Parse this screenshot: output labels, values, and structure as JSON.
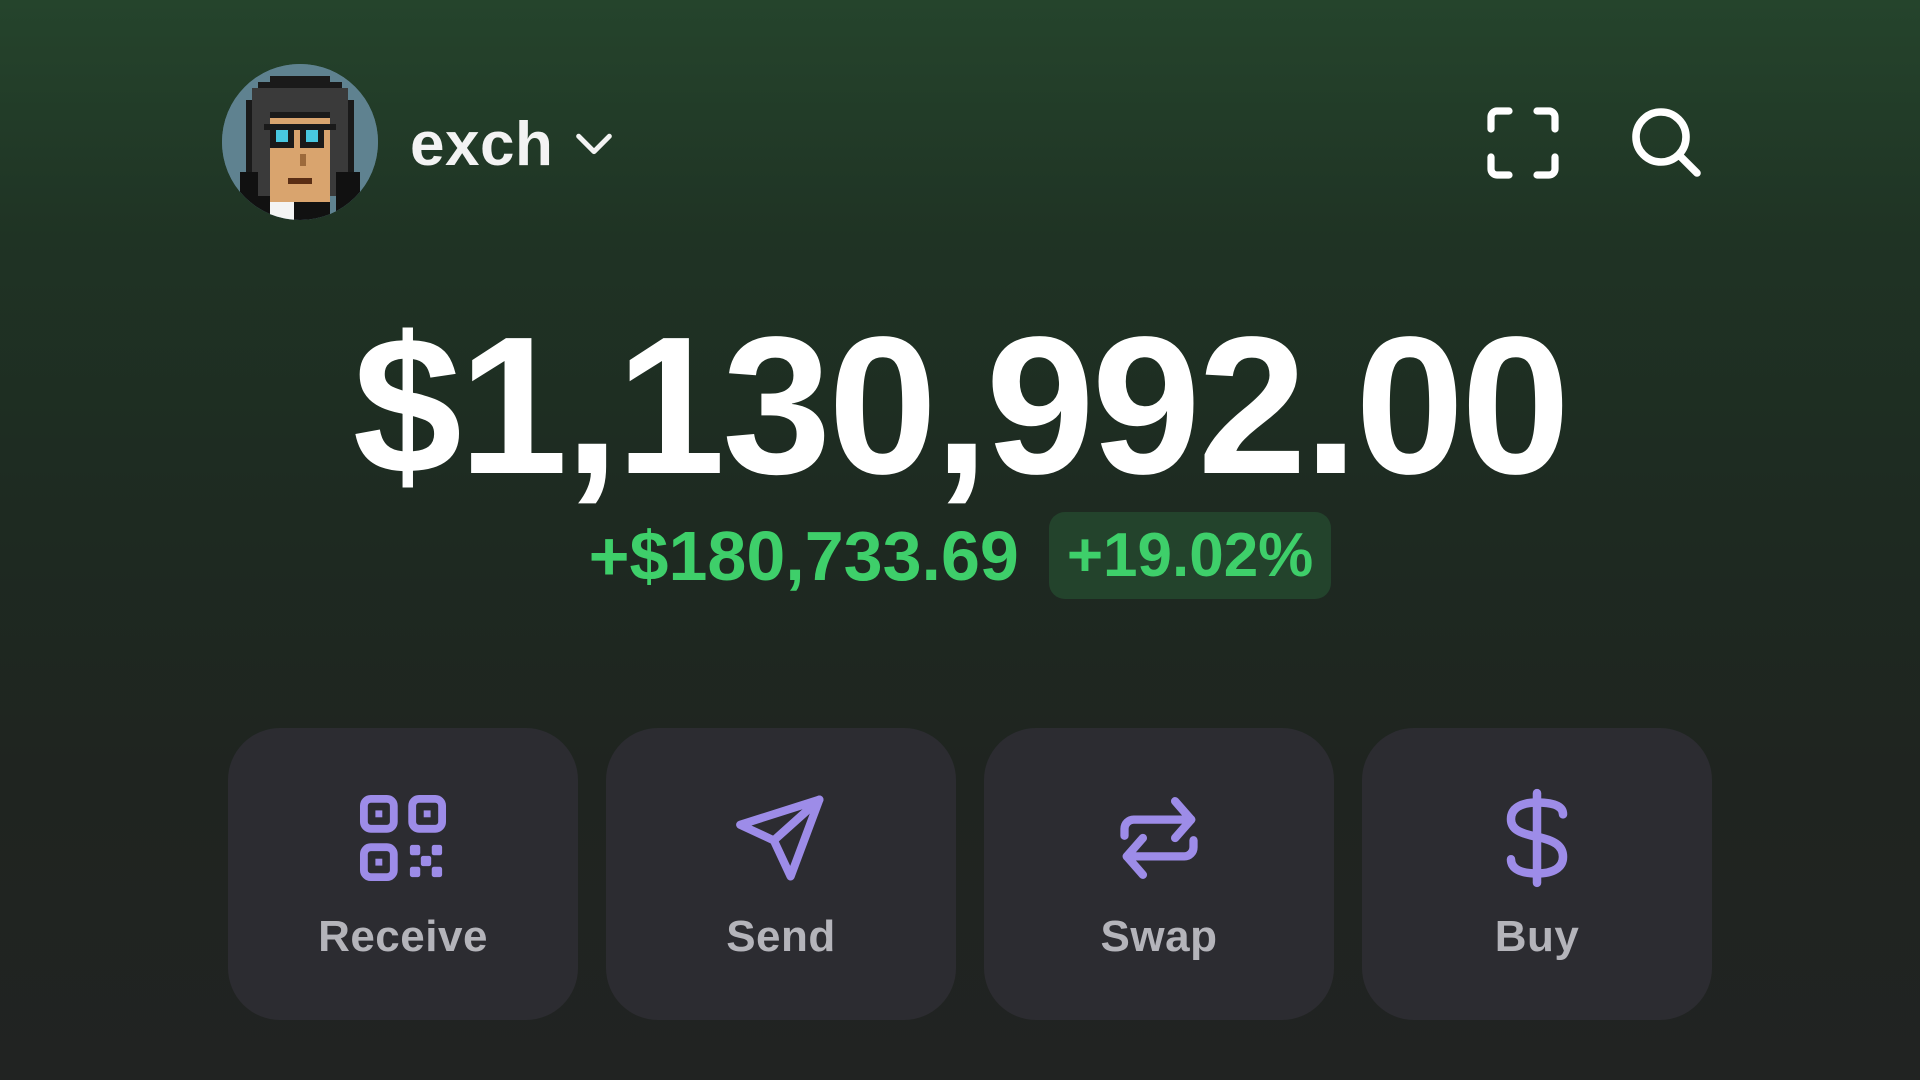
{
  "header": {
    "account_name": "exch",
    "avatar_icon": "pixel-avatar-icon",
    "account_dropdown_icon": "chevron-down-icon",
    "scan_icon": "scan-icon",
    "search_icon": "search-icon"
  },
  "portfolio": {
    "balance": "$1,130,992.00",
    "change_amount": "+$180,733.69",
    "change_percent": "+19.02%"
  },
  "actions": [
    {
      "label": "Receive",
      "icon": "qr-code-icon"
    },
    {
      "label": "Send",
      "icon": "send-icon"
    },
    {
      "label": "Swap",
      "icon": "swap-icon"
    },
    {
      "label": "Buy",
      "icon": "dollar-icon"
    }
  ],
  "colors": {
    "accent_icon": "#9d8ce8",
    "positive": "#3ecf6a",
    "positive_badge_bg": "#23432c",
    "card_bg": "#2c2c31",
    "label": "#b4b4ba"
  }
}
